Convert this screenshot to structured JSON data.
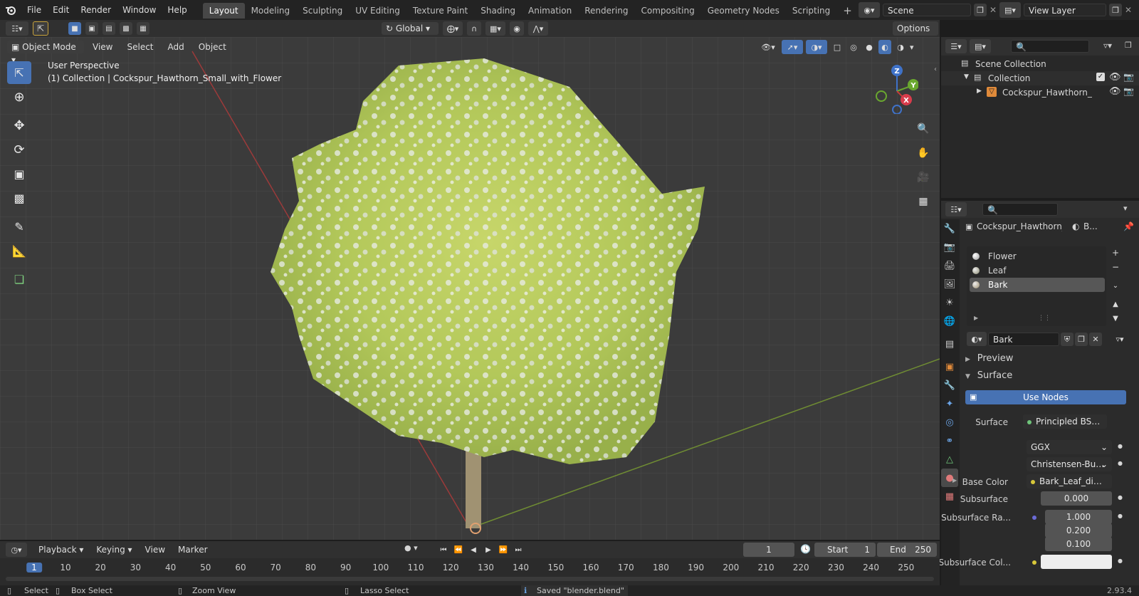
{
  "topbar": {
    "menus": [
      "File",
      "Edit",
      "Render",
      "Window",
      "Help"
    ],
    "workspaces": [
      "Layout",
      "Modeling",
      "Sculpting",
      "UV Editing",
      "Texture Paint",
      "Shading",
      "Animation",
      "Rendering",
      "Compositing",
      "Geometry Nodes",
      "Scripting"
    ],
    "active_workspace": "Layout",
    "scene": "Scene",
    "view_layer": "View Layer"
  },
  "viewport_header": {
    "mode": "Object Mode",
    "menus": [
      "View",
      "Select",
      "Add",
      "Object"
    ],
    "orientation": "Global",
    "options": "Options"
  },
  "viewport": {
    "perspective": "User Perspective",
    "collection_info": "(1) Collection | Cockspur_Hawthorn_Small_with_Flower",
    "gizmo": {
      "z": "Z",
      "y": "Y",
      "x": "X"
    }
  },
  "outliner": {
    "scene_collection": "Scene Collection",
    "collection": "Collection",
    "object": "Cockspur_Hawthorn_Sma"
  },
  "properties": {
    "object_name": "Cockspur_Hawthorn_...",
    "material_short": "B...",
    "slots": [
      "Flower",
      "Leaf",
      "Bark"
    ],
    "active_slot": "Bark",
    "material_name": "Bark",
    "panels": {
      "preview": "Preview",
      "surface": "Surface"
    },
    "use_nodes": "Use Nodes",
    "surface_label": "Surface",
    "surface_value": "Principled BSDF",
    "distribution": "GGX",
    "subsurface_method": "Christensen-Burley",
    "base_color_label": "Base Color",
    "base_color_value": "Bark_Leaf_diffuse....",
    "subsurface_label": "Subsurface",
    "subsurface_value": "0.000",
    "subsurface_radius_label": "Subsurface Ra...",
    "subsurface_radius": [
      "1.000",
      "0.200",
      "0.100"
    ],
    "subsurface_color_label": "Subsurface Col...",
    "colors": {
      "subsurface_color": "#eeeeee",
      "accent": "#4772b3"
    }
  },
  "timeline": {
    "menus": [
      "Playback",
      "Keying",
      "View",
      "Marker"
    ],
    "current_frame": "1",
    "start_label": "Start",
    "start": "1",
    "end_label": "End",
    "end": "250",
    "ruler": [
      "1",
      "10",
      "20",
      "30",
      "40",
      "50",
      "60",
      "70",
      "80",
      "90",
      "100",
      "110",
      "120",
      "130",
      "140",
      "150",
      "160",
      "170",
      "180",
      "190",
      "200",
      "210",
      "220",
      "230",
      "240",
      "250"
    ]
  },
  "statusbar": {
    "select": "Select",
    "box_select": "Box Select",
    "zoom_view": "Zoom View",
    "lasso_select": "Lasso Select",
    "message": "Saved \"blender.blend\"",
    "version": "2.93.4"
  }
}
